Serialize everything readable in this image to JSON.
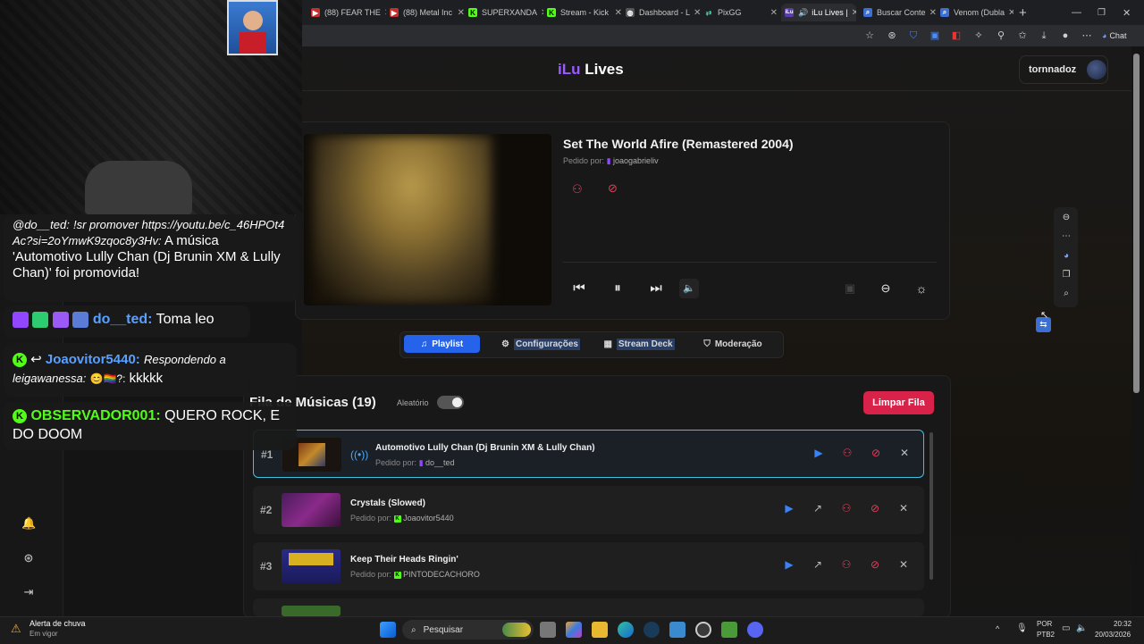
{
  "browser": {
    "tabs": [
      {
        "label": "(88) FEAR THE",
        "icon": "youtube-icon"
      },
      {
        "label": "(88) Metal Inc",
        "icon": "youtube-icon"
      },
      {
        "label": "SUPERXANDA",
        "icon": "kick-icon"
      },
      {
        "label": "Stream - Kick",
        "icon": "kick-icon"
      },
      {
        "label": "Dashboard - L",
        "icon": "globe-icon"
      },
      {
        "label": "PixGG",
        "icon": "link-icon"
      },
      {
        "label": "iLu Lives |",
        "icon": "ilu-icon"
      },
      {
        "label": "Buscar Conte",
        "icon": "search-icon"
      },
      {
        "label": "Venom (Dubla",
        "icon": "search-icon"
      }
    ],
    "chat_label": "Chat",
    "colors": {
      "accent": "#9b5cff",
      "primary": "#2563eb",
      "danger": "#d9224a",
      "highlight": "#3ec2e0"
    }
  },
  "site": {
    "logo_prefix": "iLu",
    "logo_suffix": "Lives",
    "username": "tornnadoz"
  },
  "now_playing": {
    "title": "Set The World Afire (Remastered 2004)",
    "requested_label": "Pedido por:",
    "requested_by": "joaogabrieliv"
  },
  "tabs": [
    {
      "label": "Playlist",
      "icon": "music-note-icon"
    },
    {
      "label": "Configurações",
      "icon": "gear-icon"
    },
    {
      "label": "Stream Deck",
      "icon": "grid-icon"
    },
    {
      "label": "Moderação",
      "icon": "shield-icon"
    }
  ],
  "queue": {
    "title": "Fila de Músicas (19)",
    "shuffle_label": "Aleatório",
    "shuffle_on": true,
    "clear_label": "Limpar Fila",
    "requested_label": "Pedido por:",
    "items": [
      {
        "rank": "#1",
        "title": "Automotivo Lully Chan (Dj Brunin XM & Lully Chan)",
        "by": "do__ted",
        "platform": "twitch",
        "playing": true
      },
      {
        "rank": "#2",
        "title": "Crystals (Slowed)",
        "by": "Joaovitor5440",
        "platform": "kick",
        "playing": false
      },
      {
        "rank": "#3",
        "title": "Keep Their Heads Ringin'",
        "by": "PINTODECACHORO",
        "platform": "kick",
        "playing": false
      }
    ]
  },
  "chat": {
    "messages": [
      {
        "user": "@do__ted:",
        "italic": "!sr promover https://youtu.be/c_46HPOt4Ac?si=2oYmwK9zqoc8y3Hv:",
        "text": "A música 'Automotivo Lully Chan (Dj Brunin XM & Lully Chan)' foi promovida!"
      },
      {
        "user": "do__ted:",
        "text": "Toma leo"
      },
      {
        "user": "Joaovitor5440:",
        "italic": "Respondendo a leigawanessa:",
        "emote": "😊🏳️‍🌈?:",
        "text": "kkkkk"
      },
      {
        "user": "OBSERVADOR001:",
        "text": "QUERO ROCK, E DO DOOM"
      }
    ]
  },
  "taskbar": {
    "weather_title": "Alerta de chuva",
    "weather_sub": "Em vigor",
    "search_placeholder": "Pesquisar",
    "lang": "POR",
    "layout": "PTB2",
    "time": "20:32",
    "date": "20/03/2026"
  }
}
